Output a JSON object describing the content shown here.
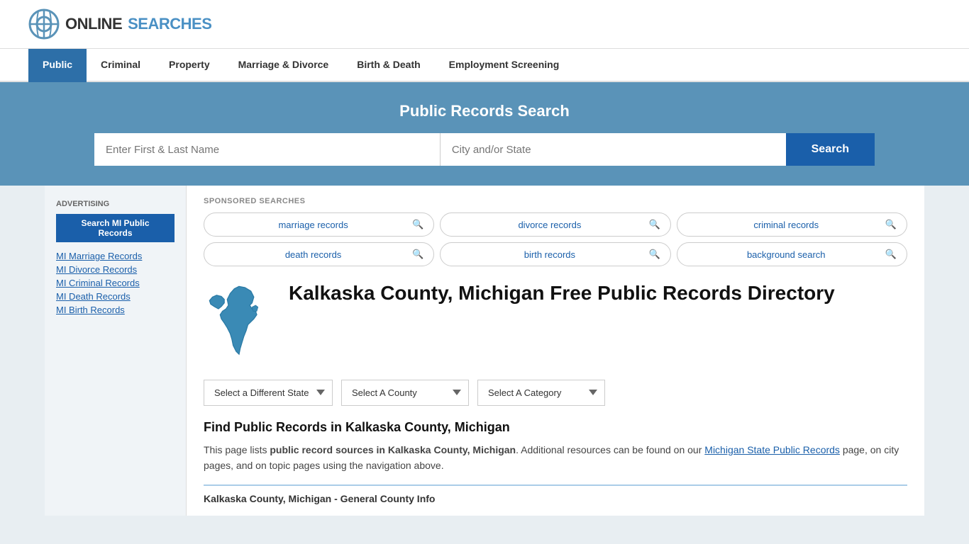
{
  "logo": {
    "text_online": "ONLINE",
    "text_searches": "SEARCHES"
  },
  "nav": {
    "items": [
      {
        "label": "Public",
        "active": true
      },
      {
        "label": "Criminal",
        "active": false
      },
      {
        "label": "Property",
        "active": false
      },
      {
        "label": "Marriage & Divorce",
        "active": false
      },
      {
        "label": "Birth & Death",
        "active": false
      },
      {
        "label": "Employment Screening",
        "active": false
      }
    ]
  },
  "hero": {
    "title": "Public Records Search",
    "name_placeholder": "Enter First & Last Name",
    "location_placeholder": "City and/or State",
    "search_label": "Search"
  },
  "sponsored": {
    "label": "SPONSORED SEARCHES",
    "pills": [
      {
        "text": "marriage records"
      },
      {
        "text": "divorce records"
      },
      {
        "text": "criminal records"
      },
      {
        "text": "death records"
      },
      {
        "text": "birth records"
      },
      {
        "text": "background search"
      }
    ]
  },
  "page": {
    "title": "Kalkaska County, Michigan Free Public Records Directory",
    "dropdowns": {
      "state": {
        "label": "Select a Different State"
      },
      "county": {
        "label": "Select A County"
      },
      "category": {
        "label": "Select A Category"
      }
    },
    "find_title": "Find Public Records in Kalkaska County, Michigan",
    "find_text_1": "This page lists ",
    "find_text_bold": "public record sources in Kalkaska County, Michigan",
    "find_text_2": ". Additional resources can be found on our ",
    "find_link": "Michigan State Public Records",
    "find_text_3": " page, on city pages, and on topic pages using the navigation above.",
    "county_info_heading": "Kalkaska County, Michigan - General County Info"
  },
  "sidebar": {
    "ad_label": "Advertising",
    "ad_btn": "Search MI Public Records",
    "links": [
      "MI Marriage Records",
      "MI Divorce Records",
      "MI Criminal Records",
      "MI Death Records",
      "MI Birth Records"
    ]
  }
}
